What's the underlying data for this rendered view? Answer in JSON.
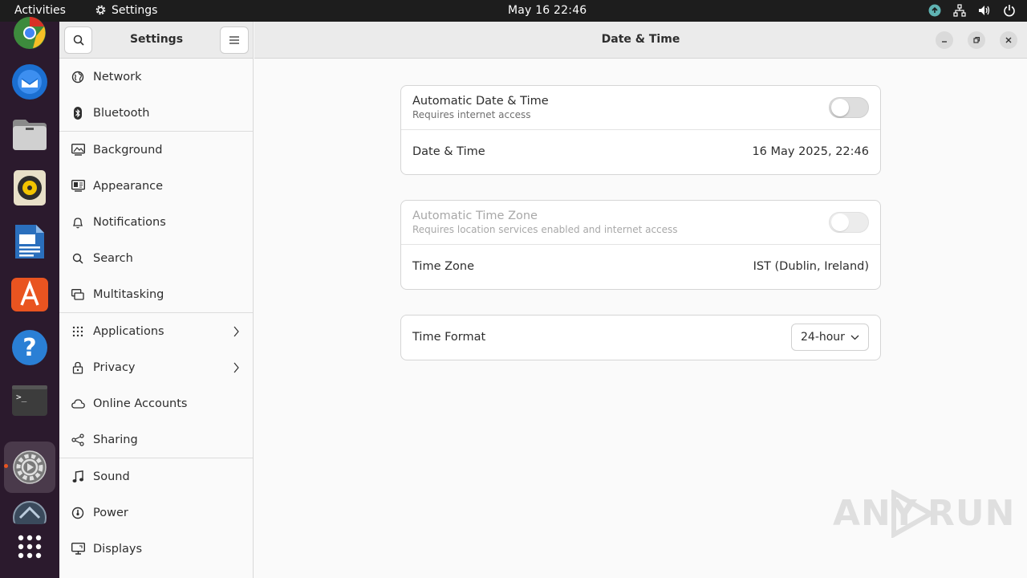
{
  "topbar": {
    "activities": "Activities",
    "app_name": "Settings",
    "clock": "May 16  22:46"
  },
  "dock": {
    "items": [
      "chrome",
      "thunderbird",
      "files",
      "rhythmbox",
      "libreoffice-writer",
      "app-center",
      "help",
      "terminal",
      "settings",
      "update-manager",
      "show-apps"
    ]
  },
  "sidebar": {
    "title": "Settings",
    "items": [
      {
        "label": "Network",
        "icon": "network-icon"
      },
      {
        "label": "Bluetooth",
        "icon": "bluetooth-icon"
      },
      {
        "label": "Background",
        "icon": "background-icon"
      },
      {
        "label": "Appearance",
        "icon": "appearance-icon"
      },
      {
        "label": "Notifications",
        "icon": "bell-icon"
      },
      {
        "label": "Search",
        "icon": "search-icon"
      },
      {
        "label": "Multitasking",
        "icon": "multitasking-icon"
      },
      {
        "label": "Applications",
        "icon": "apps-grid-icon"
      },
      {
        "label": "Privacy",
        "icon": "lock-icon"
      },
      {
        "label": "Online Accounts",
        "icon": "cloud-icon"
      },
      {
        "label": "Sharing",
        "icon": "share-icon"
      },
      {
        "label": "Sound",
        "icon": "music-note-icon"
      },
      {
        "label": "Power",
        "icon": "power-icon"
      },
      {
        "label": "Displays",
        "icon": "display-icon"
      }
    ]
  },
  "main": {
    "title": "Date & Time",
    "auto_datetime": {
      "label": "Automatic Date & Time",
      "sub": "Requires internet access",
      "enabled": false
    },
    "datetime": {
      "label": "Date & Time",
      "value": "16 May 2025, 22:46"
    },
    "auto_timezone": {
      "label": "Automatic Time Zone",
      "sub": "Requires location services enabled and internet access",
      "enabled": false,
      "disabled": true
    },
    "timezone": {
      "label": "Time Zone",
      "value": "IST (Dublin, Ireland)"
    },
    "time_format": {
      "label": "Time Format",
      "value": "24-hour"
    }
  },
  "watermark": {
    "left": "ANY",
    "right": "RUN"
  },
  "colors": {
    "accent": "#e95420",
    "dock_bg": "#2b1a2d",
    "topbar_bg": "#1d1d1d"
  }
}
